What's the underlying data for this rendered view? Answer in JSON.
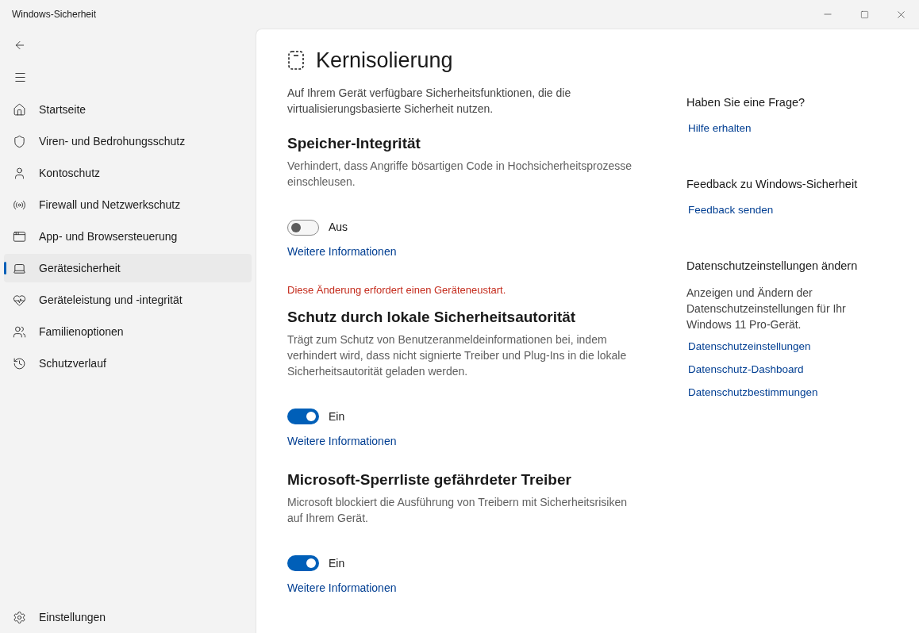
{
  "window": {
    "title": "Windows-Sicherheit"
  },
  "sidebar": {
    "items": [
      {
        "kind": "home",
        "label": "Startseite",
        "selected": false
      },
      {
        "kind": "shield",
        "label": "Viren- und Bedrohungsschutz",
        "selected": false
      },
      {
        "kind": "person",
        "label": "Kontoschutz",
        "selected": false
      },
      {
        "kind": "antenna",
        "label": "Firewall und Netzwerkschutz",
        "selected": false
      },
      {
        "kind": "window",
        "label": "App- und Browsersteuerung",
        "selected": false
      },
      {
        "kind": "laptop",
        "label": "Gerätesicherheit",
        "selected": true
      },
      {
        "kind": "heart",
        "label": "Geräteleistung und -integrität",
        "selected": false
      },
      {
        "kind": "family",
        "label": "Familienoptionen",
        "selected": false
      },
      {
        "kind": "history",
        "label": "Schutzverlauf",
        "selected": false
      }
    ],
    "settings": "Einstellungen"
  },
  "page": {
    "title": "Kernisolierung",
    "description": "Auf Ihrem Gerät verfügbare Sicherheitsfunktionen, die die virtualisierungsbasierte Sicherheit nutzen.",
    "sections": [
      {
        "title": "Speicher-Integrität",
        "description": "Verhindert, dass Angriffe bösartigen Code in Hochsicherheitsprozesse einschleusen.",
        "on": false,
        "state": "Aus",
        "link": "Weitere Informationen"
      },
      {
        "notice": "Diese Änderung erfordert einen Geräteneustart.",
        "title": "Schutz durch lokale Sicherheitsautorität",
        "description": "Trägt zum Schutz von Benutzeranmeldeinformationen bei, indem verhindert wird, dass nicht signierte Treiber und Plug-Ins in die lokale Sicherheitsautorität geladen werden.",
        "on": true,
        "state": "Ein",
        "link": "Weitere Informationen"
      },
      {
        "title": "Microsoft-Sperrliste gefährdeter Treiber",
        "description": "Microsoft blockiert die Ausführung von Treibern mit Sicherheitsrisiken auf Ihrem Gerät.",
        "on": true,
        "state": "Ein",
        "link": "Weitere Informationen"
      }
    ]
  },
  "aside": [
    {
      "title": "Haben Sie eine Frage?",
      "links": [
        "Hilfe erhalten"
      ]
    },
    {
      "title": "Feedback zu Windows-Sicherheit",
      "links": [
        "Feedback senden"
      ]
    },
    {
      "title": "Datenschutzeinstellungen ändern",
      "description": "Anzeigen und Ändern der Datenschutzeinstellungen für Ihr Windows 11 Pro-Gerät.",
      "links": [
        "Datenschutzeinstellungen",
        "Datenschutz-Dashboard",
        "Datenschutzbestimmungen"
      ]
    }
  ]
}
